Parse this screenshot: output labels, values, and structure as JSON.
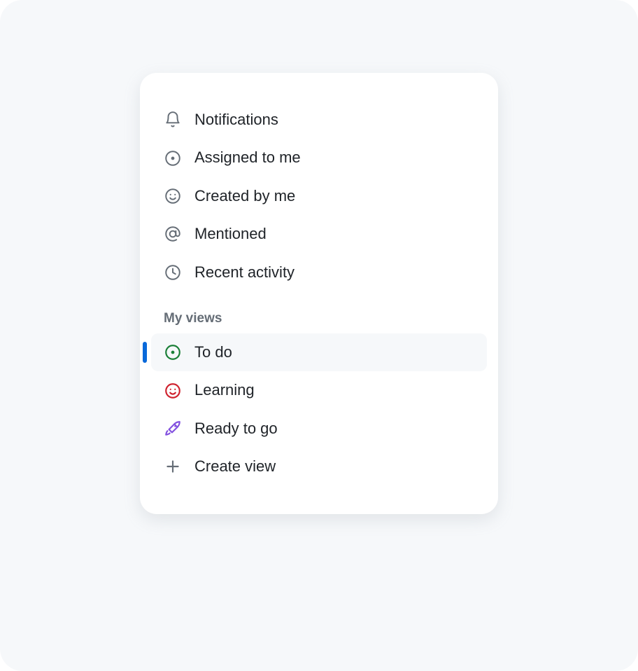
{
  "nav": {
    "items": [
      {
        "label": "Notifications"
      },
      {
        "label": "Assigned to me"
      },
      {
        "label": "Created by me"
      },
      {
        "label": "Mentioned"
      },
      {
        "label": "Recent activity"
      }
    ]
  },
  "views": {
    "header": "My views",
    "items": [
      {
        "label": "To do",
        "selected": true
      },
      {
        "label": "Learning"
      },
      {
        "label": "Ready to go"
      }
    ],
    "create_label": "Create view"
  },
  "colors": {
    "accent": "#0969da",
    "green": "#1a7f37",
    "red": "#cf222e",
    "purple": "#8250df",
    "muted": "#656d76"
  }
}
